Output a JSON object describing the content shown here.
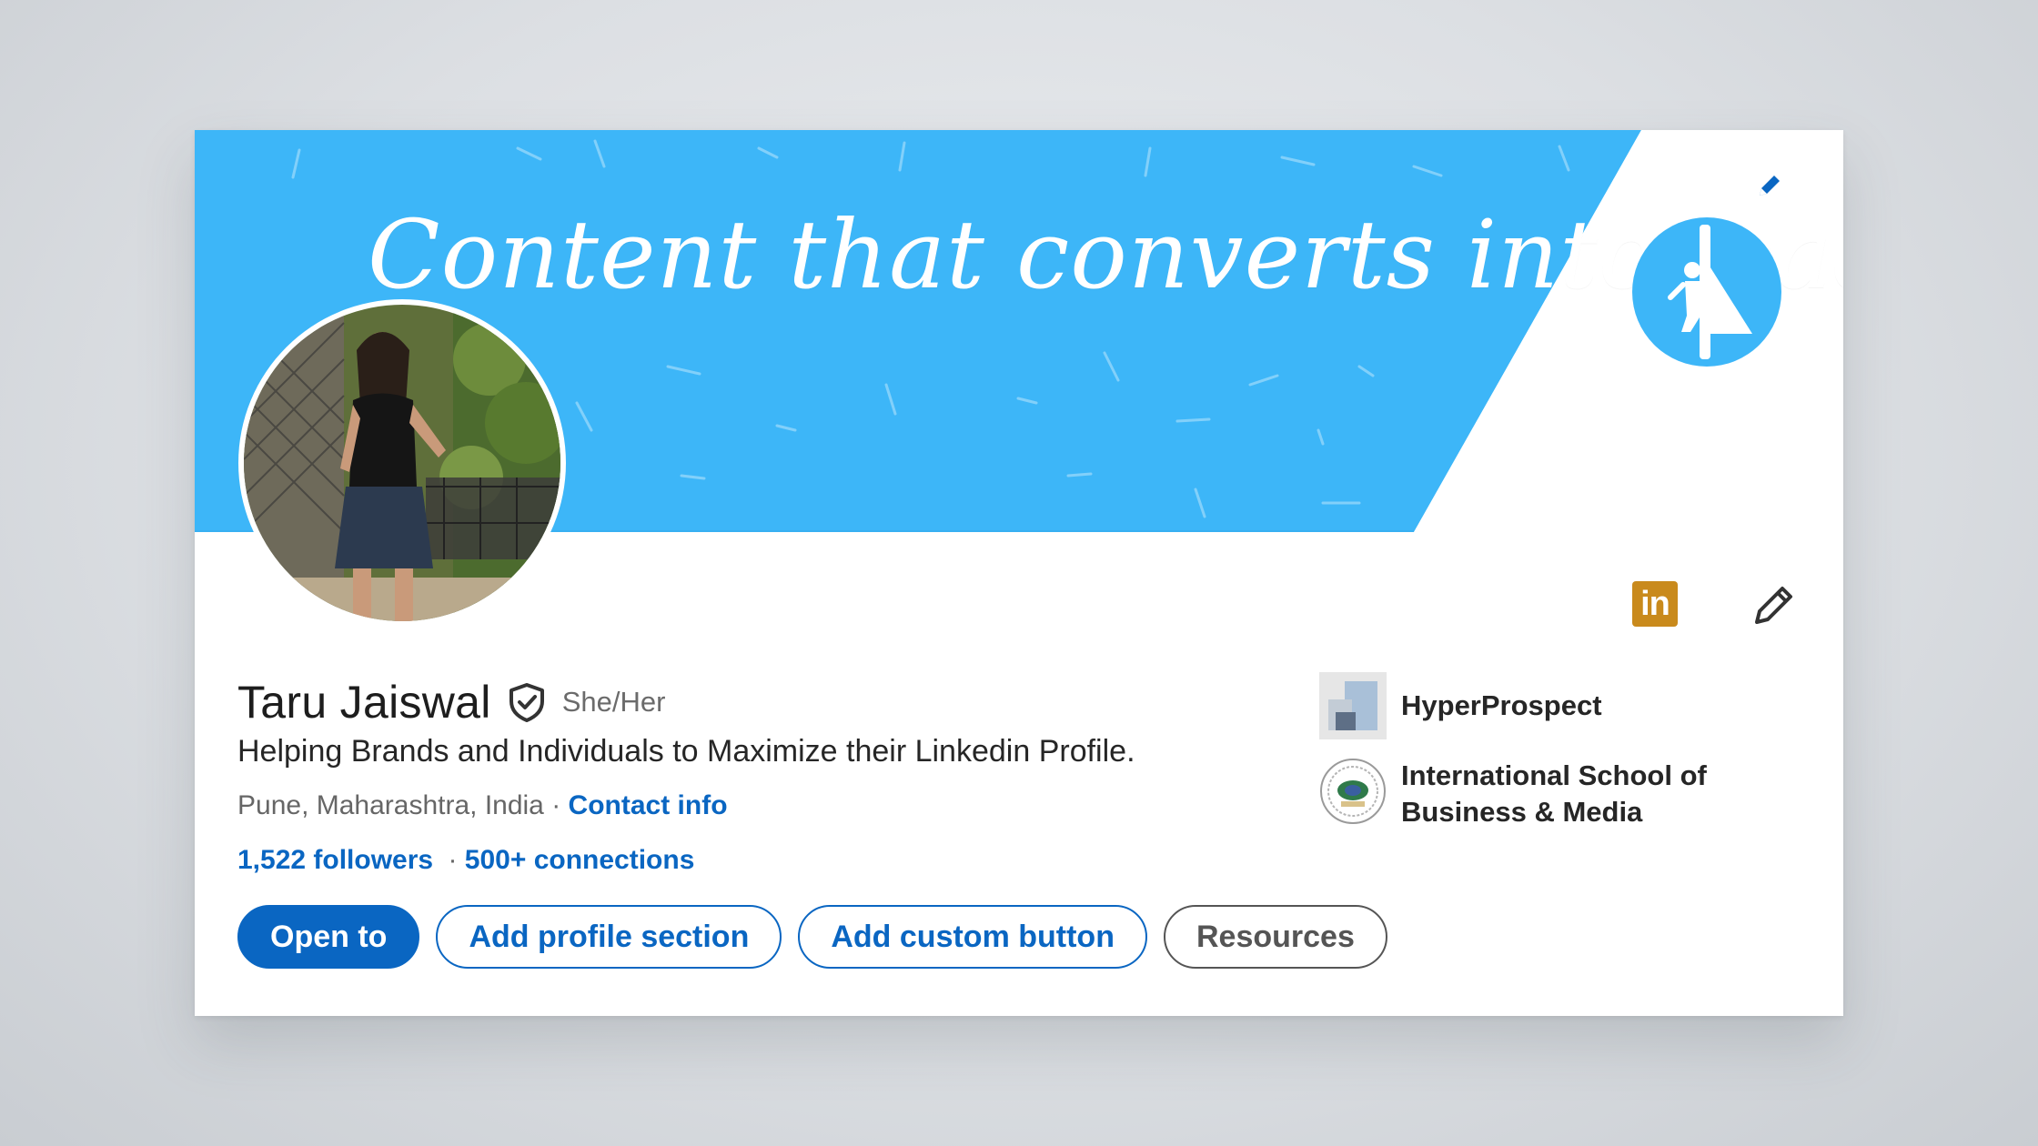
{
  "banner": {
    "tagline": "Content that converts into leads",
    "background_color": "#3db6f8",
    "brand_logo_icon": "superhero-icon"
  },
  "profile": {
    "name": "Taru Jaiswal",
    "verified_icon": "verified-shield-icon",
    "pronouns": "She/Her",
    "headline": "Helping Brands and Individuals to Maximize their Linkedin Profile.",
    "location": "Pune, Maharashtra, India",
    "location_separator": " · ",
    "contact_info_label": "Contact info",
    "followers_label": "1,522 followers",
    "stats_separator": " · ",
    "connections_label": "500+ connections"
  },
  "actions": {
    "open_to": "Open to",
    "add_profile_section": "Add profile section",
    "add_custom_button": "Add custom button",
    "resources": "Resources"
  },
  "organizations": [
    {
      "name": "HyperProspect",
      "icon": "hyperprospect-logo"
    },
    {
      "name": "International School of Business & Media",
      "icon": "isbm-logo"
    }
  ],
  "icons": {
    "linkedin_badge": "in",
    "edit_banner": "pencil-icon",
    "edit_intro": "pencil-icon"
  },
  "colors": {
    "linkedin_blue": "#0a66c2",
    "badge_gold": "#c98a1c"
  }
}
